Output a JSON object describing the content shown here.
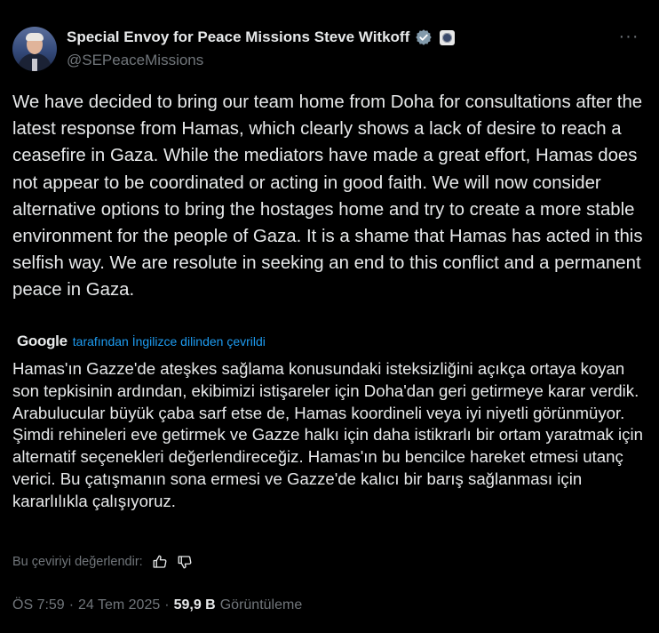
{
  "author": {
    "display_name": "Special Envoy for Peace Missions Steve Witkoff",
    "handle": "@SEPeaceMissions"
  },
  "tweet": {
    "text": "We have decided to bring our team home from Doha for consultations after the latest response from Hamas, which clearly shows a lack of desire to reach a ceasefire in Gaza. While the mediators have made a great effort, Hamas does not appear to be coordinated or acting in good faith. We will now consider alternative options to bring the hostages home and try to create a more stable environment for the people of Gaza. It is a shame that Hamas has acted in this selfish way. We are resolute in seeking an end to this conflict and a permanent peace in Gaza."
  },
  "translation": {
    "provider": "Google",
    "note": "tarafından İngilizce dilinden çevrildi",
    "text": "Hamas'ın Gazze'de ateşkes sağlama konusundaki isteksizliğini açıkça ortaya koyan son tepkisinin ardından, ekibimizi istişareler için Doha'dan geri getirmeye karar verdik. Arabulucular büyük çaba sarf etse de, Hamas koordineli veya iyi niyetli görünmüyor. Şimdi rehineleri eve getirmek ve Gazze halkı için daha istikrarlı bir ortam yaratmak için alternatif seçenekleri değerlendireceğiz. Hamas'ın bu bencilce hareket etmesi utanç verici. Bu çatışmanın sona ermesi ve Gazze'de kalıcı bir barış sağlanması için kararlılıkla çalışıyoruz.",
    "rate_label": "Bu çeviriyi değerlendir:"
  },
  "meta": {
    "time": "ÖS 7:59",
    "date": "24 Tem 2025",
    "views": "59,9 B",
    "views_label": "Görüntüleme",
    "separator": "·"
  },
  "colors": {
    "background": "#000000",
    "text": "#e7e9ea",
    "secondary": "#71767b",
    "accent": "#1d9bf0"
  },
  "icons": [
    "verified-badge-icon",
    "government-seal-icon",
    "more-icon",
    "thumbs-up-icon",
    "thumbs-down-icon"
  ]
}
